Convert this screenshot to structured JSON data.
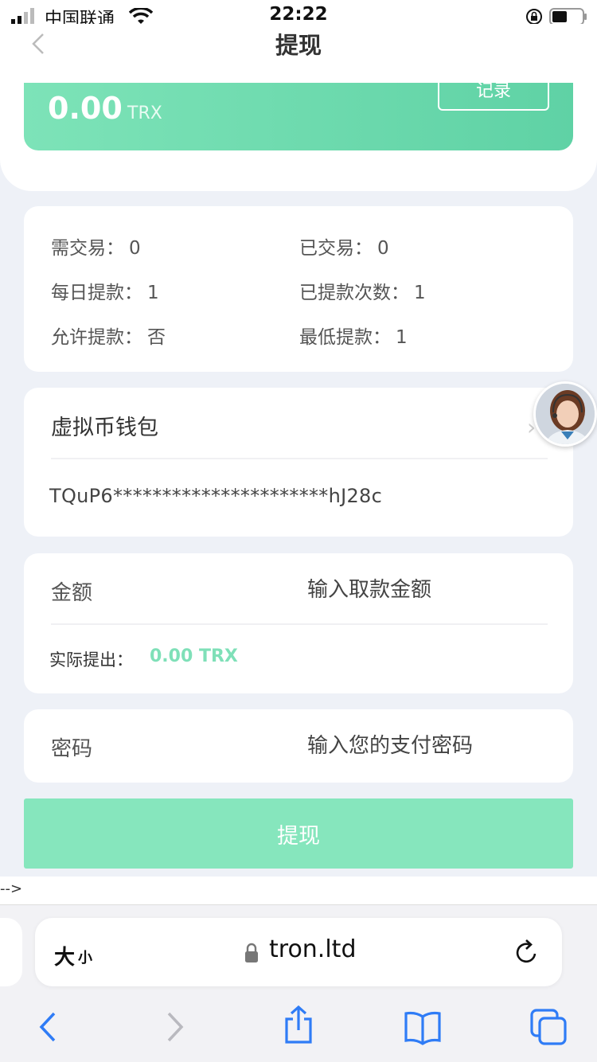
{
  "status_bar": {
    "carrier": "中国联通",
    "time": "22:22"
  },
  "nav": {
    "title": "提现"
  },
  "balance": {
    "amount": "0.00",
    "unit": "TRX",
    "record_label": "记录"
  },
  "stats": [
    {
      "label": "需交易：",
      "value": "0"
    },
    {
      "label": "已交易：",
      "value": "0"
    },
    {
      "label": "每日提款：",
      "value": "1"
    },
    {
      "label": "已提款次数：",
      "value": "1"
    },
    {
      "label": "允许提款：",
      "value": "否"
    },
    {
      "label": "最低提款：",
      "value": "1"
    }
  ],
  "wallet": {
    "title": "虚拟币钱包",
    "address": "TQuP6**********************hJ28c"
  },
  "amount": {
    "label": "金额",
    "placeholder": "输入取款金额",
    "actual_label": "实际提出：",
    "actual_value": "0.00 TRX"
  },
  "password": {
    "label": "密码",
    "placeholder": "输入您的支付密码"
  },
  "submit_label": "提现",
  "stray_text": "-->",
  "browser": {
    "text_size_big": "大",
    "text_size_small": "小",
    "url": "tron.ltd"
  },
  "colors": {
    "accent_green": "#7de3b8",
    "button_green": "#86e6bd",
    "page_bg": "#eef1f7"
  }
}
